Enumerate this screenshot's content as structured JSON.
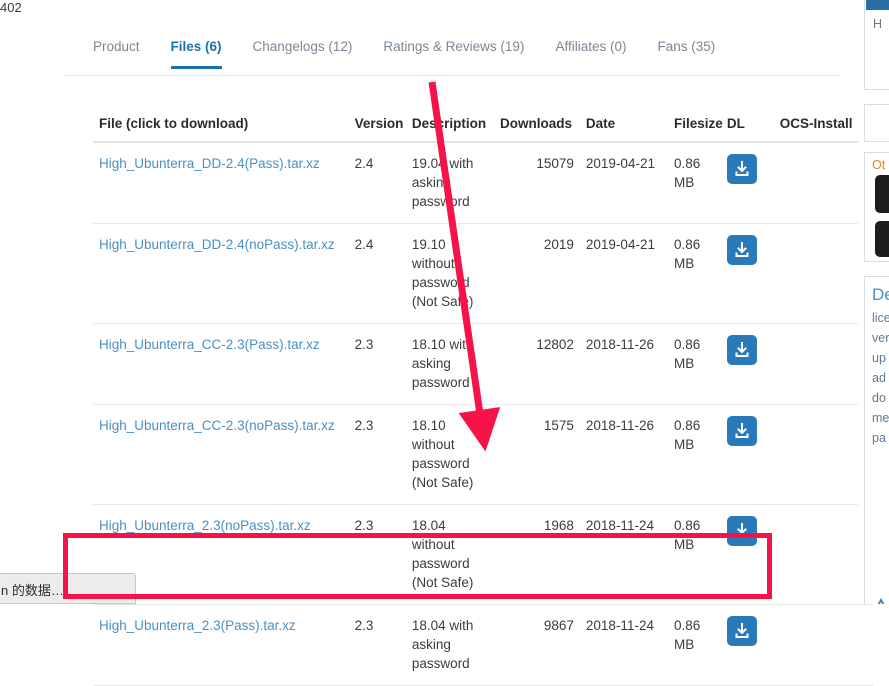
{
  "corner": {
    "number": "402"
  },
  "tabs": [
    {
      "label": "Product",
      "active": false
    },
    {
      "label": "Files (6)",
      "active": true
    },
    {
      "label": "Changelogs (12)",
      "active": false
    },
    {
      "label": "Ratings & Reviews (19)",
      "active": false
    },
    {
      "label": "Affiliates (0)",
      "active": false
    },
    {
      "label": "Fans (35)",
      "active": false
    }
  ],
  "table": {
    "headers": {
      "file": "File (click to download)",
      "version": "Version",
      "description": "Description",
      "downloads": "Downloads",
      "date": "Date",
      "filesize": "Filesize",
      "dl": "DL",
      "ocs": "OCS-Install"
    },
    "rows": [
      {
        "file": "High_Ubunterra_DD-2.4(Pass).tar.xz",
        "version": "2.4",
        "description": "19.04 with asking password",
        "downloads": "15079",
        "date": "2019-04-21",
        "filesize": "0.86 MB",
        "dl_icon": "download-icon",
        "highlighted": false
      },
      {
        "file": "High_Ubunterra_DD-2.4(noPass).tar.xz",
        "version": "2.4",
        "description": "19.10 without password (Not Safe)",
        "downloads": "2019",
        "date": "2019-04-21",
        "filesize": "0.86 MB",
        "dl_icon": "download-icon",
        "highlighted": false
      },
      {
        "file": "High_Ubunterra_CC-2.3(Pass).tar.xz",
        "version": "2.3",
        "description": "18.10 with asking password",
        "downloads": "12802",
        "date": "2018-11-26",
        "filesize": "0.86 MB",
        "dl_icon": "download-icon",
        "highlighted": false
      },
      {
        "file": "High_Ubunterra_CC-2.3(noPass).tar.xz",
        "version": "2.3",
        "description": "18.10 without password (Not Safe)",
        "downloads": "1575",
        "date": "2018-11-26",
        "filesize": "0.86 MB",
        "dl_icon": "download-icon",
        "highlighted": false
      },
      {
        "file": "High_Ubunterra_2.3(noPass).tar.xz",
        "version": "2.3",
        "description": "18.04 without password (Not Safe)",
        "downloads": "1968",
        "date": "2018-11-24",
        "filesize": "0.86 MB",
        "dl_icon": "download-icon",
        "highlighted": false
      },
      {
        "file": "High_Ubunterra_2.3(Pass).tar.xz",
        "version": "2.3",
        "description": "18.04 with asking password",
        "downloads": "9867",
        "date": "2018-11-24",
        "filesize": "0.86 MB",
        "dl_icon": "download-icon",
        "highlighted": true
      }
    ]
  },
  "rail": {
    "card1_text": "H",
    "card3_title": "Ot",
    "card4_title": "De",
    "card4_lines": [
      "lice",
      "ver",
      "up",
      "ad",
      "do",
      "me",
      "pa"
    ],
    "warn_icon": "warning-triangle-icon"
  },
  "shelf": {
    "text": "n 的数据…"
  },
  "annotation": {
    "color": "#f5134a",
    "arrow_icon": "red-arrow-icon",
    "box_icon": "red-highlight-box"
  },
  "colors": {
    "accent_blue": "#1b72b3",
    "link_blue": "#4b8fc4",
    "button_blue": "#2a79b8",
    "annotation_red": "#f5134a"
  }
}
